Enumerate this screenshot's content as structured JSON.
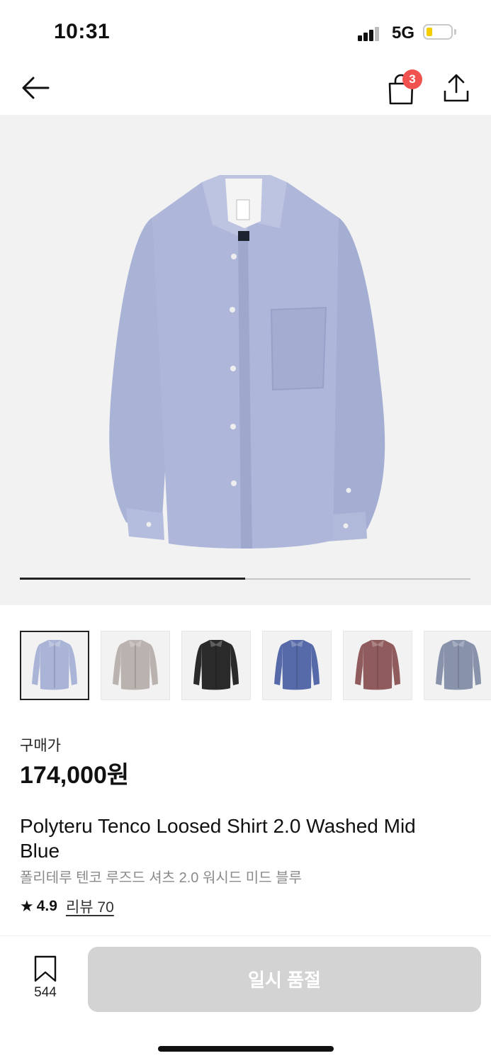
{
  "status": {
    "time": "10:31",
    "network": "5G"
  },
  "nav": {
    "back_icon": "arrow-left-icon",
    "bag_icon": "shopping-bag-icon",
    "bag_count": "3",
    "share_icon": "share-icon"
  },
  "gallery": {
    "progress": 0.5
  },
  "thumbnails": [
    {
      "name": "Mid Blue",
      "color": "#aab4d6"
    },
    {
      "name": "Grey Beige",
      "color": "#b9b2ae"
    },
    {
      "name": "Black",
      "color": "#2a2a2a"
    },
    {
      "name": "Blue",
      "color": "#5669a9"
    },
    {
      "name": "Burgundy",
      "color": "#8f5b5d"
    },
    {
      "name": "Grey Blue",
      "color": "#8892ab"
    }
  ],
  "product": {
    "price_label": "구매가",
    "price": "174,000원",
    "name_en": "Polyteru Tenco Loosed Shirt 2.0 Washed Mid Blue",
    "name_ko": "폴리테루 텐코 루즈드 셔츠 2.0 워시드 미드 블루",
    "rating_score": "4.9",
    "reviews_label": "리뷰 70"
  },
  "bottom_bar": {
    "save_count": "544",
    "soldout_label": "일시 품절"
  },
  "colors": {
    "badge": "#f0524f",
    "shirt_main": "#aab4d6",
    "button_disabled": "#d3d3d3"
  }
}
